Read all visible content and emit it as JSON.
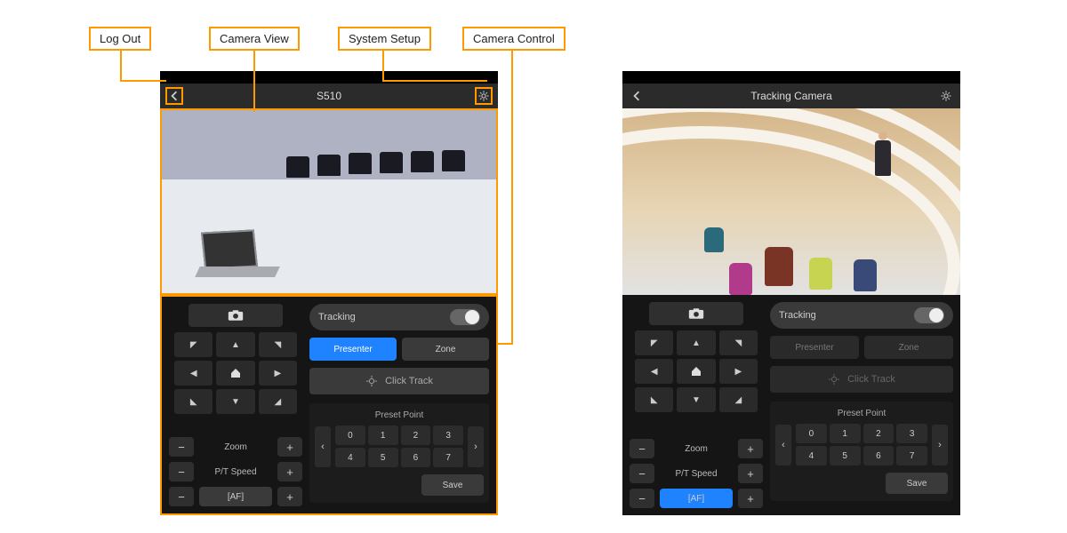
{
  "callouts": {
    "log_out": "Log Out",
    "camera_view": "Camera View",
    "system_setup": "System Setup",
    "camera_control": "Camera Control"
  },
  "left_app": {
    "title": "S510",
    "tracking_label": "Tracking",
    "presenter_label": "Presenter",
    "zone_label": "Zone",
    "click_track_label": "Click Track",
    "preset_title": "Preset Point",
    "presets": [
      "0",
      "1",
      "2",
      "3",
      "4",
      "5",
      "6",
      "7"
    ],
    "zoom_label": "Zoom",
    "pt_speed_label": "P/T Speed",
    "af_label": "[AF]",
    "save_label": "Save",
    "icons": {
      "back": "back-chevron-icon",
      "gear": "gear-icon",
      "camera": "camera-icon",
      "home": "home-icon",
      "target": "target-icon"
    }
  },
  "right_app": {
    "title": "Tracking Camera",
    "tracking_label": "Tracking",
    "presenter_label": "Presenter",
    "zone_label": "Zone",
    "click_track_label": "Click Track",
    "preset_title": "Preset Point",
    "presets": [
      "0",
      "1",
      "2",
      "3",
      "4",
      "5",
      "6",
      "7"
    ],
    "zoom_label": "Zoom",
    "pt_speed_label": "P/T Speed",
    "af_label": "[AF]",
    "save_label": "Save"
  },
  "glyphs": {
    "minus": "−",
    "plus": "+",
    "left": "◀",
    "right": "▶",
    "up": "▲",
    "down": "▼",
    "chev_left": "‹",
    "chev_right": "›"
  }
}
